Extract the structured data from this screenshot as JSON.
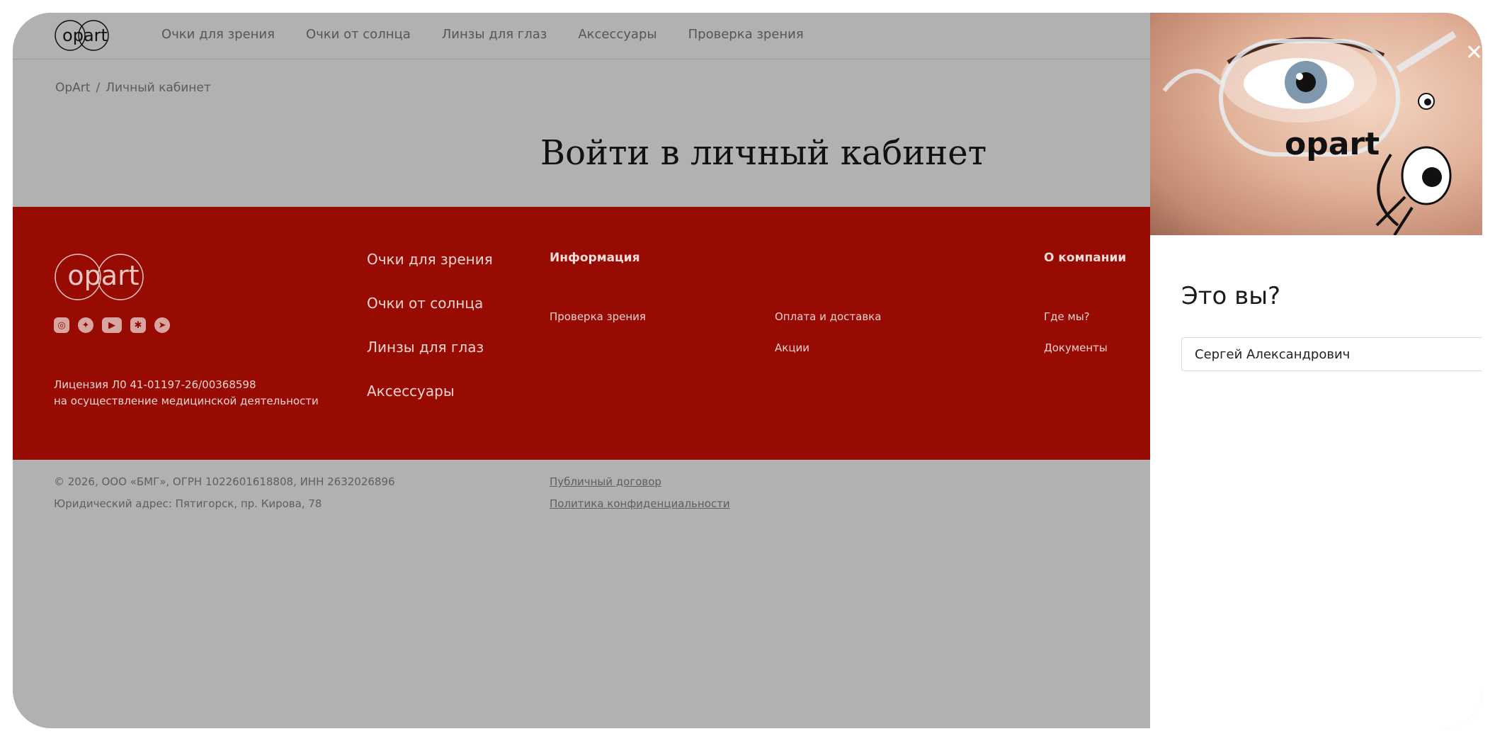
{
  "brand": {
    "logo_text": "opart"
  },
  "header": {
    "nav": [
      "Очки для зрения",
      "Очки от солнца",
      "Линзы для глаз",
      "Аксессуары",
      "Проверка зрения"
    ]
  },
  "breadcrumb": {
    "home": "OpArt",
    "sep": "/",
    "current": "Личный кабинет"
  },
  "page": {
    "title": "Войти в личный кабинет"
  },
  "footer": {
    "socials": [
      "instagram-icon",
      "star-icon",
      "youtube-icon",
      "vk-icon",
      "telegram-icon"
    ],
    "license_line1": "Лицензия Л0 41-01197-26/00368598",
    "license_line2": "на осуществление медицинской деятельности",
    "main_links": [
      "Очки для зрения",
      "Очки от солнца",
      "Линзы для глаз",
      "Аксессуары"
    ],
    "info_title": "Информация",
    "info_links_a": [
      "Проверка зрения"
    ],
    "info_links_b": [
      "Оплата и доставка",
      "Акции"
    ],
    "company_title": "О компании",
    "company_links": [
      "Где мы?",
      "Документы"
    ],
    "copyright": "© 2026, ООО «БМГ», ОГРН 1022601618808, ИНН 2632026896",
    "address": "Юридический адрес: Пятигорск, пр. Кирова, 78",
    "public_contract": "Публичный договор",
    "privacy_policy": "Политика конфиденциальности"
  },
  "panel": {
    "close_icon": "close-icon",
    "hero_logo": "opart",
    "title": "Это вы?",
    "name_value": "Сергей Александрович"
  }
}
